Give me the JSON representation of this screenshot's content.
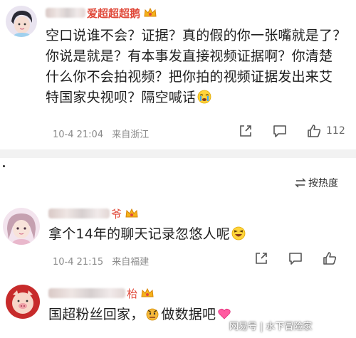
{
  "comments": [
    {
      "username": "爱超超超鹅",
      "lines": [
        "空口说谁不会？证据？真的假的你一张嘴就是了？",
        "你说是就是？有本事发直接视频证据啊？你清楚",
        "什么你不会拍视频？把你拍的视频证据发出来艾",
        "特国家央视呗？隔空喊话"
      ],
      "date": "10-4 21:04",
      "location": "来自浙江",
      "likes": "112"
    },
    {
      "username": "爷",
      "lines": [
        "拿个14年的聊天记录忽悠人呢"
      ],
      "date": "10-4 21:15",
      "location": "来自福建",
      "likes": ""
    },
    {
      "username": "枱",
      "lines": [
        "国超粉丝回家，",
        "做数据吧"
      ],
      "date": "",
      "location": "",
      "likes": ""
    }
  ],
  "sort": {
    "label": "按热度",
    "icon": "sort-icon"
  },
  "watermark": {
    "part1": "网易号",
    "sep": "|",
    "part2": "水下冒险家"
  },
  "colors": {
    "username": "#e0493a",
    "meta": "#8a8a8a",
    "divider": "#f2f2f2"
  }
}
